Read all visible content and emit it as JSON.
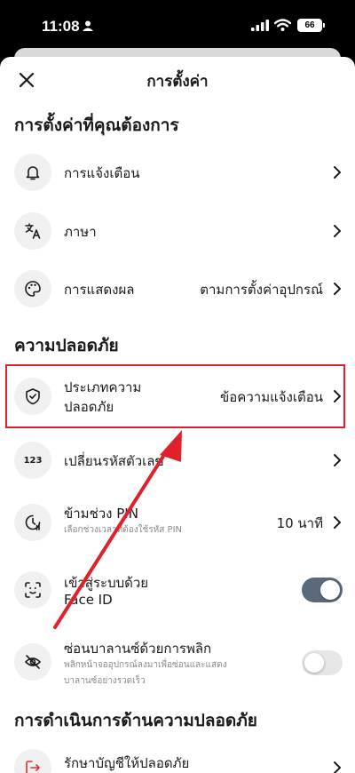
{
  "status_bar": {
    "time": "11:08",
    "battery": "66"
  },
  "header": {
    "title": "การตั้งค่า"
  },
  "sections": {
    "preferences": "การตั้งค่าที่คุณต้องการ",
    "security": "ความปลอดภัย",
    "security_actions": "การดำเนินการด้านความปลอดภัย"
  },
  "preferences": {
    "notifications": {
      "label": "การแจ้งเตือน",
      "icon": "bell-icon"
    },
    "language": {
      "label": "ภาษา",
      "icon": "translate-icon"
    },
    "display": {
      "label": "การแสดงผล",
      "value": "ตามการตั้งค่าอุปกรณ์",
      "icon": "palette-icon"
    }
  },
  "security": {
    "security_type": {
      "label_line1": "ประเภทความ",
      "label_line2": "ปลอดภัย",
      "value": "ข้อความแจ้งเตือน",
      "icon": "shield-icon"
    },
    "change_pin": {
      "label": "เปลี่ยนรหัสตัวเลข",
      "icon": "123-icon"
    },
    "skip_pin": {
      "label": "ข้ามช่วง PIN",
      "sub": "เลือกช่วงเวลาที่ต้องใช้รหัส PIN",
      "value": "10 นาที",
      "icon": "timer-icon"
    },
    "face_id": {
      "label_line1": "เข้าสู่ระบบด้วย",
      "label_line2": "Face ID",
      "enabled": true,
      "icon": "face-id-icon"
    },
    "hide_balance": {
      "label": "ซ่อนบาลานซ์ด้วยการพลิก",
      "sub_line1": "พลิกหน้าจออุปกรณ์ลงมาเพื่อซ่อนและแสดง",
      "sub_line2": "บาลานซ์อย่างรวดเร็ว",
      "enabled": false,
      "icon": "eye-off-icon"
    }
  },
  "security_actions": {
    "keep_safe": {
      "label": "รักษาบัญชีให้ปลอดภัย",
      "icon": "logout-icon"
    }
  },
  "colors": {
    "highlight": "#e0202a",
    "toggle_on": "#5b6a7a",
    "icon_bg": "#f0f0f0"
  }
}
